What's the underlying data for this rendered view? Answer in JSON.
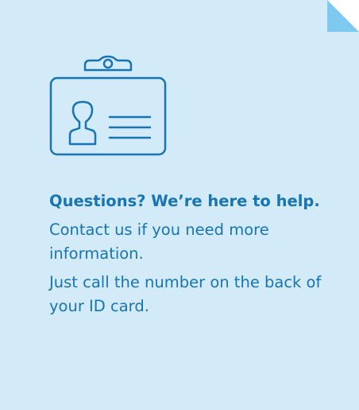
{
  "panel": {
    "icon": "id-badge-icon",
    "heading": "Questions? We’re here to help.",
    "paragraphs": [
      "Contact us if you need more information.",
      "Just call the number on the back of your ID card."
    ],
    "colors": {
      "background": "#d3ebf8",
      "fold": "#7dc9ef",
      "accent": "#1774b5"
    }
  }
}
